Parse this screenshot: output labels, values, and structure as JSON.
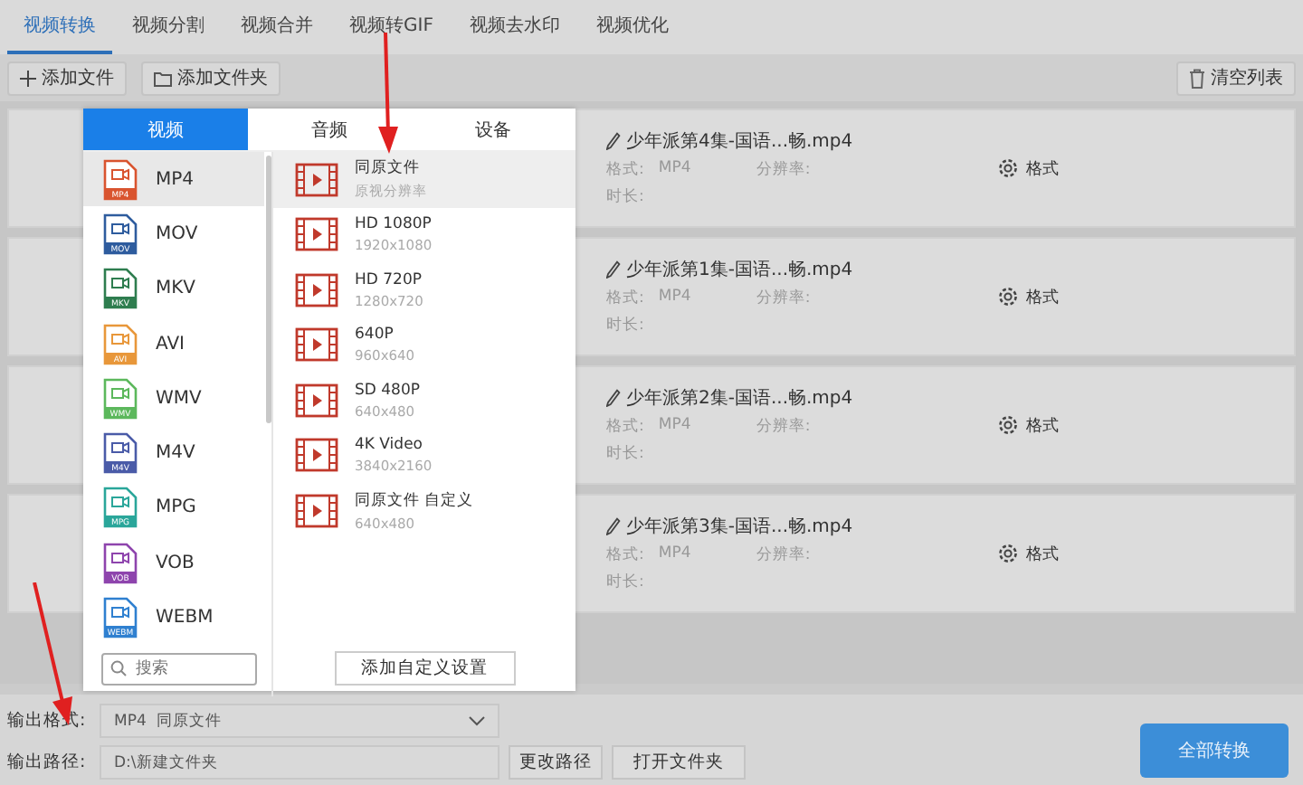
{
  "tabs": [
    {
      "label": "视频转换",
      "selected": true
    },
    {
      "label": "视频分割",
      "selected": false
    },
    {
      "label": "视频合并",
      "selected": false
    },
    {
      "label": "视频转GIF",
      "selected": false
    },
    {
      "label": "视频去水印",
      "selected": false
    },
    {
      "label": "视频优化",
      "selected": false
    }
  ],
  "toolbar": {
    "add_file": "添加文件",
    "add_folder": "添加文件夹",
    "clear_list": "清空列表"
  },
  "files": [
    {
      "name": "少年派第4集-国语...畅.mp4",
      "format_label": "格式:",
      "format": "MP4",
      "resolution_label": "分辨率:",
      "duration_label": "时长:",
      "settings": "格式"
    },
    {
      "name": "少年派第1集-国语...畅.mp4",
      "format_label": "格式:",
      "format": "MP4",
      "resolution_label": "分辨率:",
      "duration_label": "时长:",
      "settings": "格式"
    },
    {
      "name": "少年派第2集-国语...畅.mp4",
      "format_label": "格式:",
      "format": "MP4",
      "resolution_label": "分辨率:",
      "duration_label": "时长:",
      "settings": "格式"
    },
    {
      "name": "少年派第3集-国语...畅.mp4",
      "format_label": "格式:",
      "format": "MP4",
      "resolution_label": "分辨率:",
      "duration_label": "时长:",
      "settings": "格式"
    }
  ],
  "format_popup": {
    "tabs": [
      {
        "label": "视频",
        "selected": true
      },
      {
        "label": "音频",
        "selected": false
      },
      {
        "label": "设备",
        "selected": false
      }
    ],
    "formats": [
      {
        "label": "MP4",
        "badge": "MP4",
        "color": "#d9542f",
        "selected": true
      },
      {
        "label": "MOV",
        "badge": "MOV",
        "color": "#2e5c9e",
        "selected": false
      },
      {
        "label": "MKV",
        "badge": "MKV",
        "color": "#2e7d4f",
        "selected": false
      },
      {
        "label": "AVI",
        "badge": "AVI",
        "color": "#e8973a",
        "selected": false
      },
      {
        "label": "WMV",
        "badge": "WMV",
        "color": "#5cb85c",
        "selected": false
      },
      {
        "label": "M4V",
        "badge": "M4V",
        "color": "#4a5ba8",
        "selected": false
      },
      {
        "label": "MPG",
        "badge": "MPG",
        "color": "#2aa69a",
        "selected": false
      },
      {
        "label": "VOB",
        "badge": "VOB",
        "color": "#8e44ad",
        "selected": false
      },
      {
        "label": "WEBM",
        "badge": "WEBM",
        "color": "#2f80d0",
        "selected": false
      }
    ],
    "search": {
      "placeholder": "搜索"
    },
    "presets": [
      {
        "title": "同原文件",
        "subtitle": "原视分辨率",
        "selected": true
      },
      {
        "title": "HD 1080P",
        "subtitle": "1920x1080",
        "selected": false
      },
      {
        "title": "HD 720P",
        "subtitle": "1280x720",
        "selected": false
      },
      {
        "title": "640P",
        "subtitle": "960x640",
        "selected": false
      },
      {
        "title": "SD 480P",
        "subtitle": "640x480",
        "selected": false
      },
      {
        "title": "4K Video",
        "subtitle": "3840x2160",
        "selected": false
      },
      {
        "title": "同原文件 自定义",
        "subtitle": "640x480",
        "selected": false
      }
    ],
    "add_custom": "添加自定义设置"
  },
  "bottom": {
    "output_format_label": "输出格式:",
    "output_format_value": "MP4",
    "output_format_preset": "同原文件",
    "output_path_label": "输出路径:",
    "output_path_value": "D:\\新建文件夹",
    "change_path": "更改路径",
    "open_folder": "打开文件夹",
    "convert_all": "全部转换"
  }
}
